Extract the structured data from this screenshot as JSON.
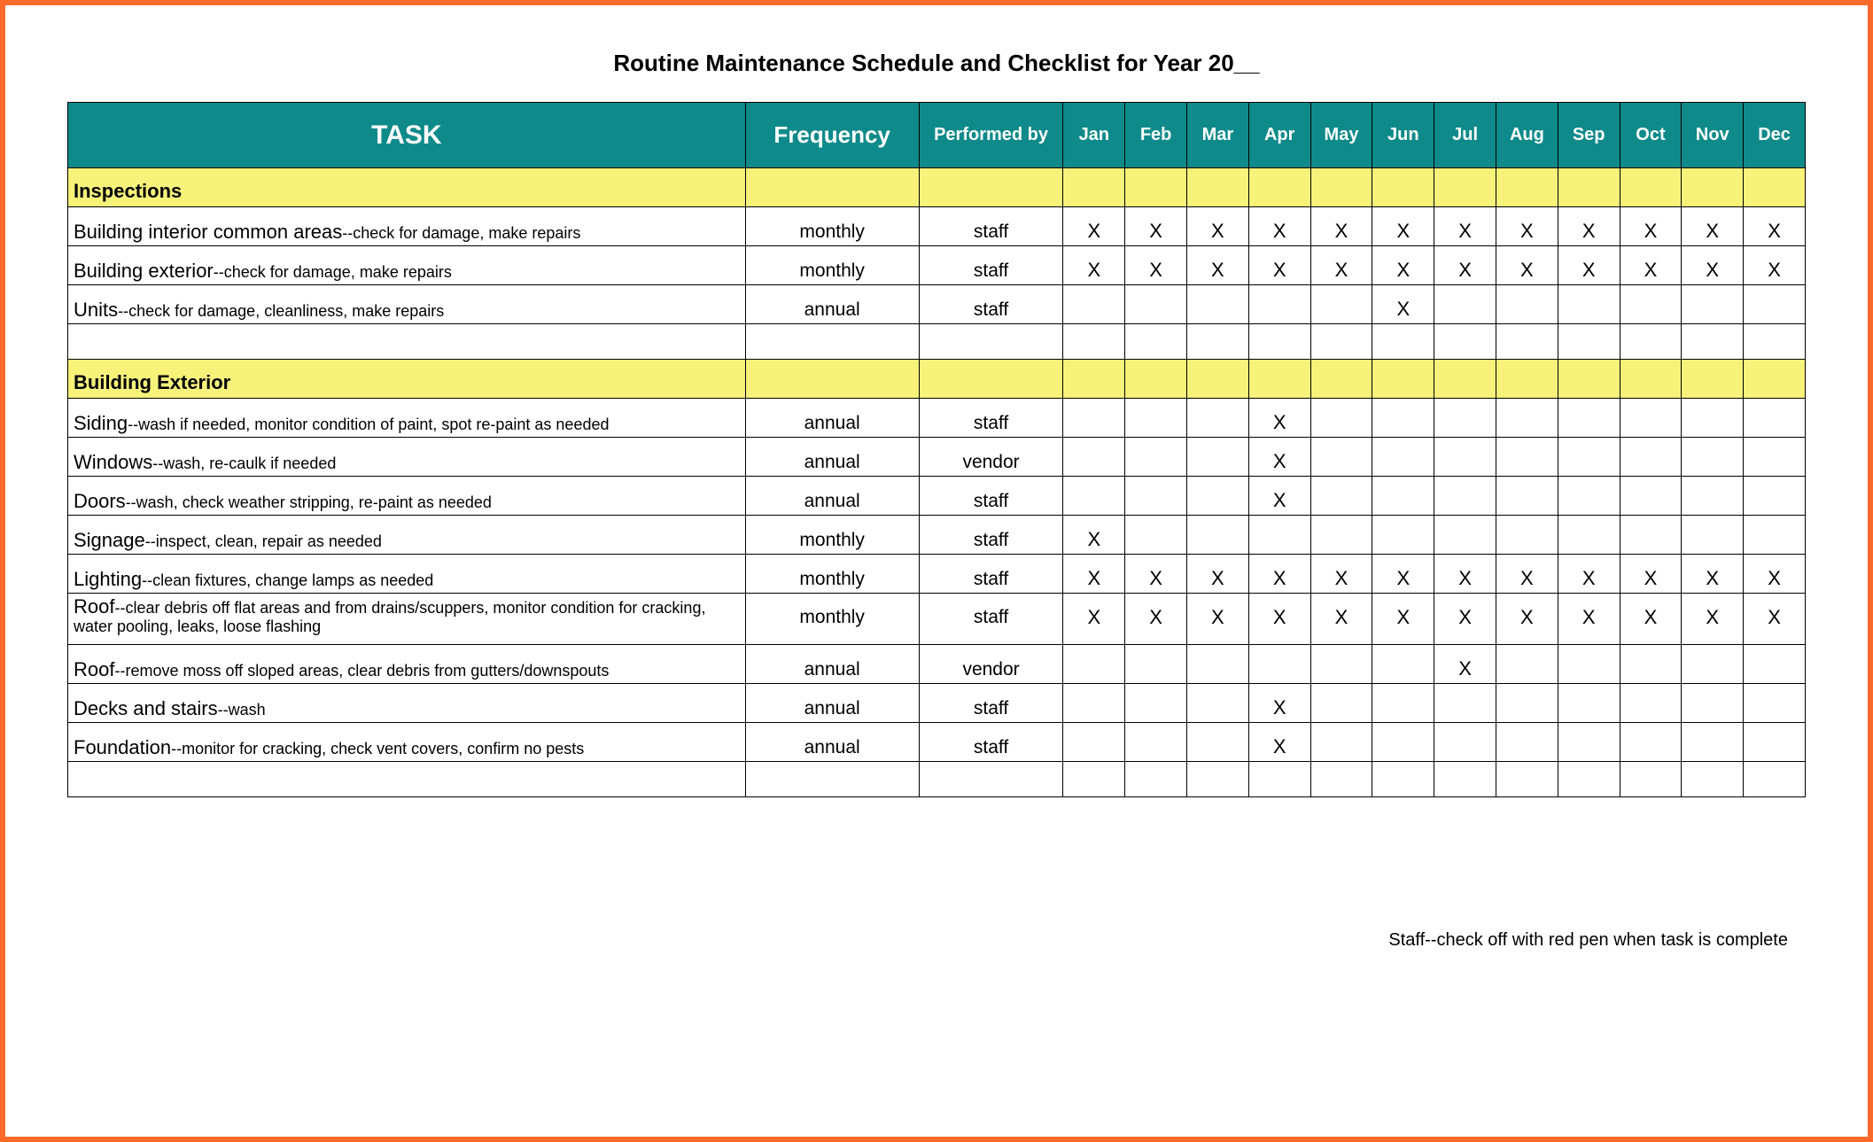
{
  "title": "Routine Maintenance Schedule and Checklist for Year 20__",
  "headers": {
    "task": "TASK",
    "frequency": "Frequency",
    "performed_by": "Performed by"
  },
  "months": [
    "Jan",
    "Feb",
    "Mar",
    "Apr",
    "May",
    "Jun",
    "Jul",
    "Aug",
    "Sep",
    "Oct",
    "Nov",
    "Dec"
  ],
  "sections": [
    {
      "name": "Inspections",
      "rows": [
        {
          "task_main": "Building interior common areas",
          "task_desc": "--check for damage, make repairs",
          "frequency": "monthly",
          "performed_by": "staff",
          "marks": [
            "X",
            "X",
            "X",
            "X",
            "X",
            "X",
            "X",
            "X",
            "X",
            "X",
            "X",
            "X"
          ]
        },
        {
          "task_main": "Building exterior",
          "task_desc": "--check for damage, make repairs",
          "frequency": "monthly",
          "performed_by": "staff",
          "marks": [
            "X",
            "X",
            "X",
            "X",
            "X",
            "X",
            "X",
            "X",
            "X",
            "X",
            "X",
            "X"
          ]
        },
        {
          "task_main": "Units",
          "task_desc": "--check for damage, cleanliness, make repairs",
          "frequency": "annual",
          "performed_by": "staff",
          "marks": [
            "",
            "",
            "",
            "",
            "",
            "X",
            "",
            "",
            "",
            "",
            "",
            ""
          ]
        }
      ],
      "trailing_empty": 1
    },
    {
      "name": "Building Exterior",
      "rows": [
        {
          "task_main": "Siding",
          "task_desc": "--wash if needed, monitor condition of paint, spot re-paint as needed",
          "frequency": "annual",
          "performed_by": "staff",
          "marks": [
            "",
            "",
            "",
            "X",
            "",
            "",
            "",
            "",
            "",
            "",
            "",
            ""
          ]
        },
        {
          "task_main": "Windows",
          "task_desc": "--wash, re-caulk if needed",
          "frequency": "annual",
          "performed_by": "vendor",
          "marks": [
            "",
            "",
            "",
            "X",
            "",
            "",
            "",
            "",
            "",
            "",
            "",
            ""
          ]
        },
        {
          "task_main": "Doors",
          "task_desc": "--wash, check weather stripping, re-paint as needed",
          "frequency": "annual",
          "performed_by": "staff",
          "marks": [
            "",
            "",
            "",
            "X",
            "",
            "",
            "",
            "",
            "",
            "",
            "",
            ""
          ]
        },
        {
          "task_main": "Signage",
          "task_desc": "--inspect, clean, repair as needed",
          "frequency": "monthly",
          "performed_by": "staff",
          "marks": [
            "X",
            "",
            "",
            "",
            "",
            "",
            "",
            "",
            "",
            "",
            "",
            ""
          ]
        },
        {
          "task_main": "Lighting",
          "task_desc": "--clean fixtures, change lamps as needed",
          "frequency": "monthly",
          "performed_by": "staff",
          "marks": [
            "X",
            "X",
            "X",
            "X",
            "X",
            "X",
            "X",
            "X",
            "X",
            "X",
            "X",
            "X"
          ]
        },
        {
          "task_main": "Roof",
          "task_desc": "--clear debris off flat areas and from drains/scuppers, monitor condition for cracking, water pooling, leaks, loose flashing",
          "frequency": "monthly",
          "performed_by": "staff",
          "marks": [
            "X",
            "X",
            "X",
            "X",
            "X",
            "X",
            "X",
            "X",
            "X",
            "X",
            "X",
            "X"
          ],
          "tall": true
        },
        {
          "task_main": "Roof",
          "task_desc": "--remove moss off sloped areas, clear debris from gutters/downspouts",
          "frequency": "annual",
          "performed_by": "vendor",
          "marks": [
            "",
            "",
            "",
            "",
            "",
            "",
            "X",
            "",
            "",
            "",
            "",
            ""
          ]
        },
        {
          "task_main": "Decks and stairs",
          "task_desc": "--wash",
          "frequency": "annual",
          "performed_by": "staff",
          "marks": [
            "",
            "",
            "",
            "X",
            "",
            "",
            "",
            "",
            "",
            "",
            "",
            ""
          ]
        },
        {
          "task_main": "Foundation",
          "task_desc": "--monitor for cracking, check vent covers, confirm no pests",
          "frequency": "annual",
          "performed_by": "staff",
          "marks": [
            "",
            "",
            "",
            "X",
            "",
            "",
            "",
            "",
            "",
            "",
            "",
            ""
          ]
        }
      ],
      "trailing_empty": 1
    }
  ],
  "footnote": "Staff--check off with red pen when task is complete"
}
